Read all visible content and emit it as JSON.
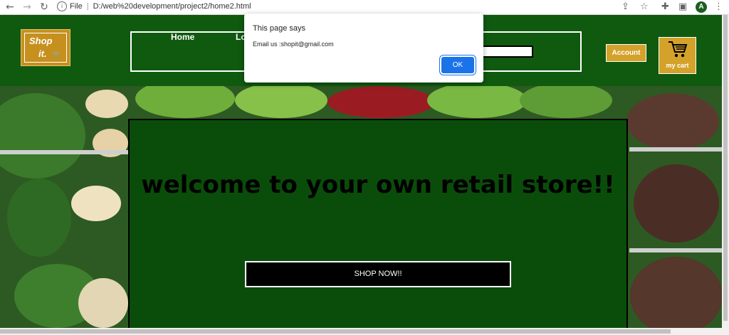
{
  "browser": {
    "file_label": "File",
    "url": "D:/web%20development/project2/home2.html",
    "profile_initial": "A"
  },
  "site": {
    "logo_line1": "Shop",
    "logo_line2": "it.",
    "nav": {
      "home": "Home",
      "login": "Lo"
    },
    "account_label": "Account",
    "cart_label": "my cart",
    "hero_title": "welcome to your own retail store!!",
    "shop_button": "SHOP NOW!!"
  },
  "alert": {
    "title": "This page says",
    "message": "Email us :shopit@gmail.com",
    "ok_label": "OK"
  },
  "colors": {
    "header_green": "#0f5a0f",
    "card_green": "#0a4d0a",
    "accent_gold": "#d4a22a",
    "alert_button": "#1a73e8"
  },
  "icons": [
    "back-arrow-icon",
    "forward-arrow-icon",
    "reload-icon",
    "info-icon",
    "share-icon",
    "star-icon",
    "extensions-icon",
    "sidebar-icon",
    "menu-icon",
    "cart-icon"
  ]
}
